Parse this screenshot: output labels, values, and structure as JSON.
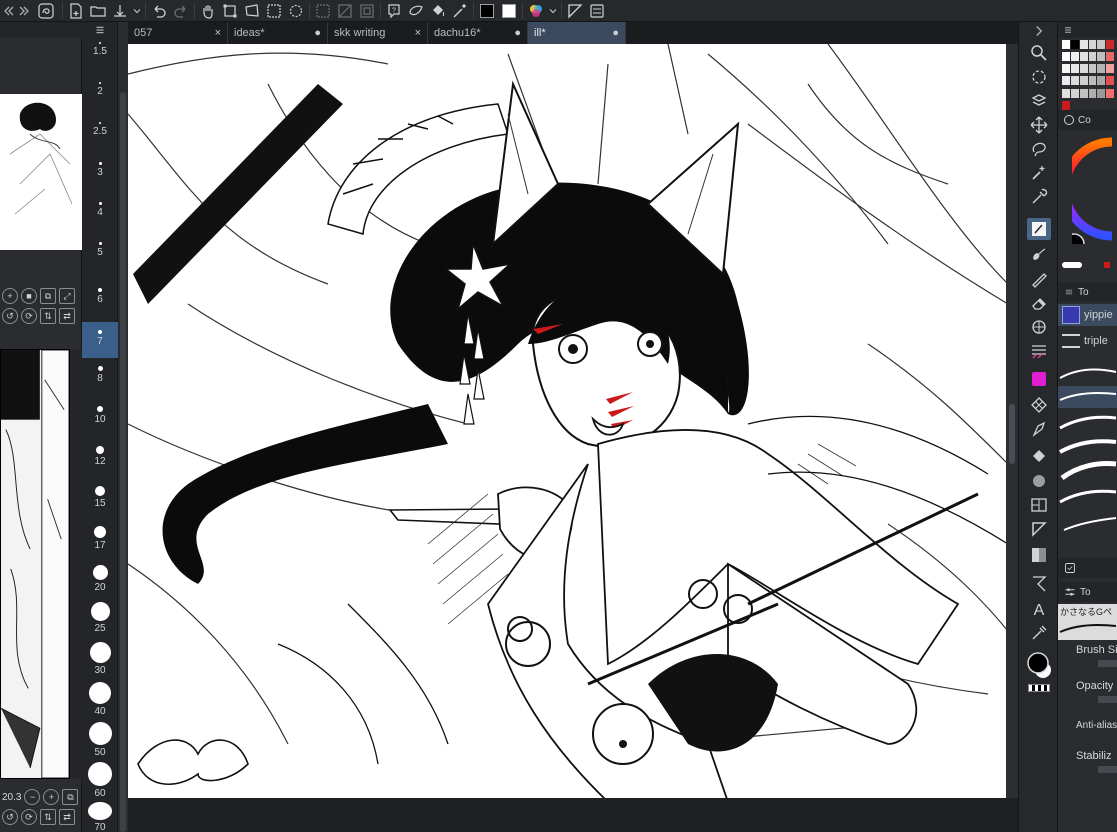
{
  "tabs": [
    {
      "label": "057",
      "close": "×",
      "active": false
    },
    {
      "label": "ideas*",
      "close": "●",
      "active": false
    },
    {
      "label": "skk writing",
      "close": "×",
      "active": false
    },
    {
      "label": "dachu16*",
      "close": "●",
      "active": false
    },
    {
      "label": "ill*",
      "close": "●",
      "active": true
    }
  ],
  "brush_sizes": [
    {
      "label": "1.5"
    },
    {
      "label": "2"
    },
    {
      "label": "2.5"
    },
    {
      "label": "3"
    },
    {
      "label": "4"
    },
    {
      "label": "5"
    },
    {
      "label": "6"
    },
    {
      "label": "7",
      "active": true
    },
    {
      "label": "8"
    },
    {
      "label": "10"
    },
    {
      "label": "12"
    },
    {
      "label": "15"
    },
    {
      "label": "17"
    },
    {
      "label": "20"
    },
    {
      "label": "25"
    },
    {
      "label": "30"
    },
    {
      "label": "40"
    },
    {
      "label": "50"
    },
    {
      "label": "60"
    },
    {
      "label": "70"
    }
  ],
  "navigator": {
    "zoom": "20.3"
  },
  "right_panel": {
    "header_color": "Co",
    "sub_tool_header": "To",
    "brushes": [
      {
        "label": "yippie",
        "selected": true
      },
      {
        "label": "triple",
        "selected": false
      }
    ],
    "tool_prop_header": "To",
    "brush_name": "かさなるGペ",
    "props": {
      "brush_size": "Brush Siz",
      "opacity": "Opacity",
      "antialias": "Anti-aliasin",
      "stabilization": "Stabiliz"
    }
  },
  "colors": {
    "accent": "#3b4a5e",
    "main_color": "#000000",
    "sub_color": "#ffffff",
    "face_mark": "#cc1a1a"
  }
}
